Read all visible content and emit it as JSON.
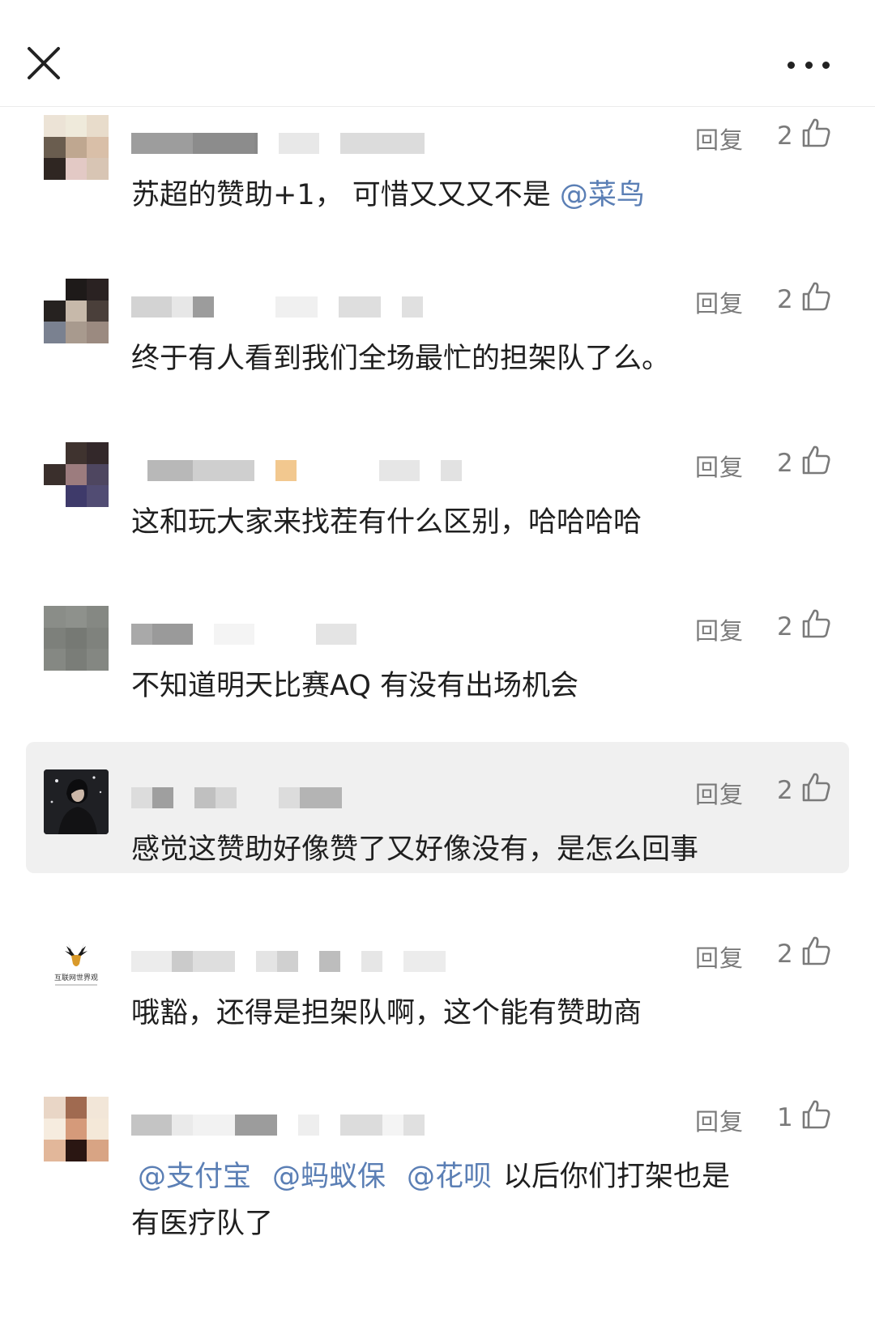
{
  "header": {
    "close_icon": "close-icon",
    "more_icon": "more-horizontal-icon"
  },
  "reply_label": "回复",
  "comments": [
    {
      "likes": "2",
      "text": "苏超的赞助+1， 可惜又又又不是 ",
      "mentions": [
        "@菜鸟"
      ]
    },
    {
      "likes": "2",
      "text": "终于有人看到我们全场最忙的担架队了么。"
    },
    {
      "likes": "2",
      "text": "这和玩大家来找茬有什么区别，哈哈哈哈"
    },
    {
      "likes": "2",
      "text": "不知道明天比赛AQ 有没有出场机会"
    },
    {
      "likes": "2",
      "text": "感觉这赞助好像赞了又好像没有，是怎么回事",
      "highlighted": true
    },
    {
      "likes": "2",
      "text": "哦豁，还得是担架队啊，这个能有赞助商",
      "avatar_logo_text": "互联网世界观"
    },
    {
      "likes": "1",
      "mentions": [
        "@支付宝",
        "@蚂蚁保",
        "@花呗"
      ],
      "text_after_mentions": "以后你们打架也是",
      "text_line2": "有医疗队了"
    }
  ]
}
